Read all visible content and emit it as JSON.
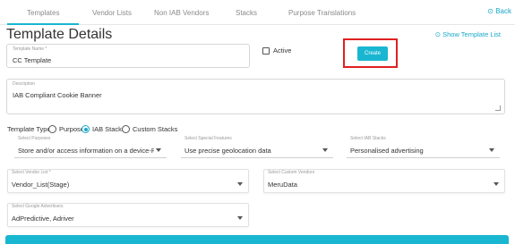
{
  "tabs": [
    {
      "label": "Templates",
      "active": true
    },
    {
      "label": "Vendor Lists",
      "active": false
    },
    {
      "label": "Non IAB Vendors",
      "active": false
    },
    {
      "label": "Stacks",
      "active": false
    },
    {
      "label": "Purpose Translations",
      "active": false
    }
  ],
  "back_link": "Back",
  "page_title": "Template Details",
  "show_template_list": "Show Template List",
  "template_name": {
    "label": "Template Name *",
    "value": "CC Template"
  },
  "active": {
    "label": "Active",
    "checked": false
  },
  "create_button": "Create",
  "description": {
    "label": "Description",
    "value": "IAB Compliant Cookie Banner"
  },
  "template_type": {
    "label": "Template Type:",
    "options": [
      {
        "label": "Purpose",
        "selected": false
      },
      {
        "label": "IAB Stacks",
        "selected": true
      },
      {
        "label": "Custom Stacks",
        "selected": false
      }
    ]
  },
  "select_purposes": {
    "label": "Select Purposes",
    "value": "Store and/or access information on a device-Purp..."
  },
  "select_special_features": {
    "label": "Select Special Features",
    "value": "Use precise geolocation data"
  },
  "select_iab_stacks": {
    "label": "Select IAB Stacks",
    "value": "Personalised advertising"
  },
  "select_vendor_list": {
    "label": "Select Vendor List *",
    "value": "Vendor_List(Stage)"
  },
  "select_custom_vendors": {
    "label": "Select Custom Vendors",
    "value": "MeruData"
  },
  "select_google_advertisers": {
    "label": "Select Google Advertisers",
    "value": "AdPredictive, Adriver"
  },
  "colors": {
    "accent": "#19b6d1",
    "highlight_box": "#e02020"
  }
}
